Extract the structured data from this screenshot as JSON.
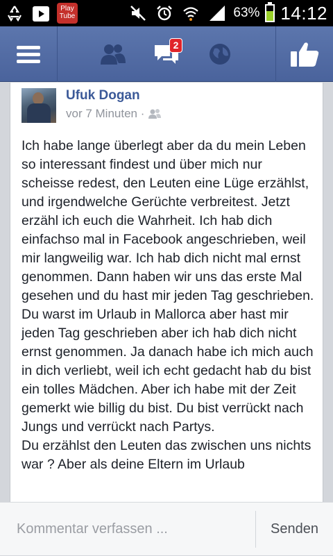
{
  "status_bar": {
    "playtube_label": "Play\nTube",
    "battery_percent": "63%",
    "battery_level": 0.63,
    "time": "14:12",
    "icons": [
      "recycle-icon",
      "play-store-icon",
      "playtube-icon",
      "mute-icon",
      "alarm-icon",
      "wifi-icon",
      "signal-icon",
      "battery-icon"
    ]
  },
  "nav": {
    "icons": [
      "menu-icon",
      "friend-requests-icon",
      "messages-icon",
      "notifications-globe-icon",
      "like-icon"
    ],
    "messages_badge": "2"
  },
  "post": {
    "author": "Ufuk Dogan",
    "time": "vor 7 Minuten ·",
    "audience_icon": "friends-icon",
    "text": "Ich habe lange überlegt aber da du mein Leben so interessant findest und über mich nur scheisse redest, den Leuten eine Lüge erzählst, und irgendwelche Gerüchte verbreitest. Jetzt erzähl ich euch die Wahrheit. Ich hab dich einfachso mal in Facebook angeschrieben, weil mir langweilig war. Ich hab dich nicht mal ernst genommen. Dann haben wir uns das erste Mal gesehen und du hast mir jeden Tag geschrieben. Du warst im Urlaub in Mallorca aber hast mir jeden Tag geschrieben aber ich hab dich nicht ernst genommen. Ja danach habe ich mich auch in dich verliebt, weil ich echt gedacht hab du bist ein tolles Mädchen. Aber ich habe mit der Zeit gemerkt wie billig du bist. Du bist verrückt nach Jungs und verrückt nach Partys.\nDu erzählst den Leuten das zwischen uns nichts war ? Aber als deine Eltern im Urlaub"
  },
  "comment": {
    "placeholder": "Kommentar verfassen ...",
    "send_label": "Senden"
  },
  "colors": {
    "brand": "#3b5998",
    "top_bar": "#4e69a2",
    "badge": "#e0242a"
  }
}
